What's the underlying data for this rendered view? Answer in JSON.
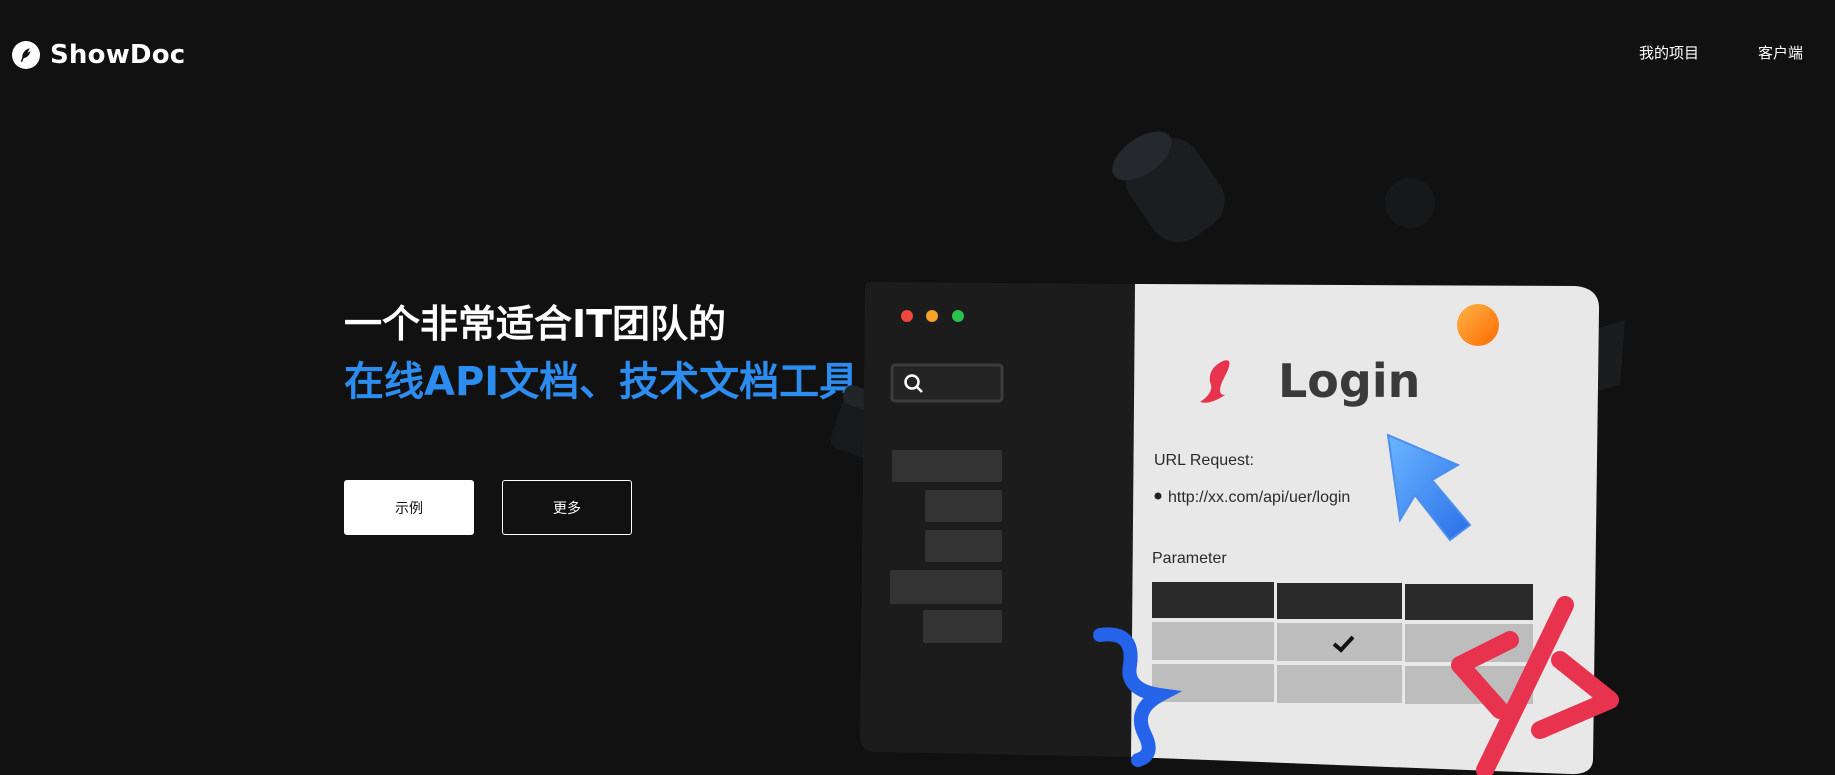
{
  "header": {
    "logo_text": "ShowDoc",
    "nav": [
      {
        "label": "我的项目"
      },
      {
        "label": "客户端"
      }
    ]
  },
  "hero": {
    "title_line1": "一个非常适合IT团队的",
    "title_line2": "在线API文档、技术文档工具",
    "buttons": {
      "example_label": "示例",
      "more_label": "更多"
    }
  },
  "illustration": {
    "login_title": "Login",
    "url_request_label": "URL Request:",
    "url_value": "http://xx.com/api/uer/login",
    "parameter_label": "Parameter"
  },
  "colors": {
    "background": "#111111",
    "accent_blue": "#2d8cf0",
    "accent_red": "#e8334f",
    "accent_orange": "#ff8a1f"
  }
}
